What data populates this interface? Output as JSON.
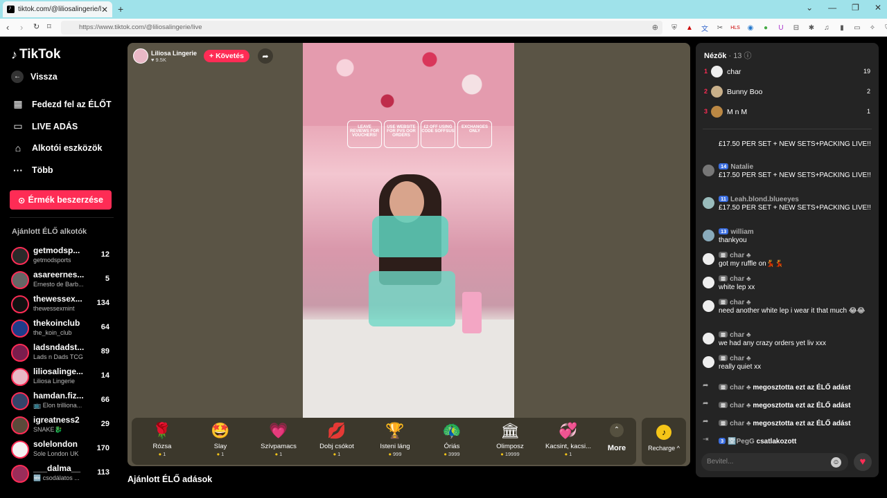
{
  "browser": {
    "tab_title": "tiktok.com/@liliosalingerie/li",
    "url": "https://www.tiktok.com/@liliosalingerie/live"
  },
  "sidebar": {
    "logo": "TikTok",
    "back": "Vissza",
    "items": [
      {
        "label": "Fedezd fel az ÉLŐT",
        "icon": "calendar-icon"
      },
      {
        "label": "LIVE ADÁS",
        "icon": "video-camera-icon"
      },
      {
        "label": "Alkotói eszközök",
        "icon": "lightbulb-icon"
      },
      {
        "label": "Több",
        "icon": "more-dots-icon"
      }
    ],
    "coins_button": "Érmék beszerzése",
    "section_title": "Ajánlott ÉLŐ alkotók",
    "creators": [
      {
        "name": "getmodsp...",
        "sub": "getmodsports",
        "count": "12"
      },
      {
        "name": "asareernes...",
        "sub": "Ernesto de Barb...",
        "count": "5"
      },
      {
        "name": "thewessex...",
        "sub": "thewessexmint",
        "count": "134"
      },
      {
        "name": "thekoinclub",
        "sub": "the_koin_club",
        "count": "64"
      },
      {
        "name": "ladsndadst...",
        "sub": "Lads n Dads TCG",
        "count": "89"
      },
      {
        "name": "liliosalinge...",
        "sub": "Liliosa Lingerie",
        "count": "14"
      },
      {
        "name": "hamdan.fiz...",
        "sub": "📺 Elon trilliona...",
        "count": "66"
      },
      {
        "name": "igreatness2",
        "sub": "SNAKE🐉",
        "count": "29"
      },
      {
        "name": "solelondon",
        "sub": "Sole London UK",
        "count": "170"
      },
      {
        "name": "___dalma__",
        "sub": "🆕 csodálatos ...",
        "count": "113"
      }
    ]
  },
  "stream": {
    "host_name": "Liliosa Lingerie",
    "host_likes": "♥ 9.5K",
    "follow": "+ Követés",
    "signs": [
      "LEAVE REVIEWS FOR VOUCHERS!",
      "USE WEBSITE FOR PVS OOR ORDERS",
      "£2 OFF USING CODE SOFFSUS",
      "EXCHANGES ONLY"
    ],
    "gifts": [
      {
        "name": "Rózsa",
        "price": "1",
        "icon": "🌹"
      },
      {
        "name": "Slay",
        "price": "1",
        "icon": "🤩"
      },
      {
        "name": "Szívpamacs",
        "price": "1",
        "icon": "💗"
      },
      {
        "name": "Dobj csókot",
        "price": "1",
        "icon": "💋"
      },
      {
        "name": "Isteni láng",
        "price": "999",
        "icon": "🏆"
      },
      {
        "name": "Óriás",
        "price": "3999",
        "icon": "🦚"
      },
      {
        "name": "Olimposz",
        "price": "19999",
        "icon": "🏛"
      },
      {
        "name": "Kacsint, kacsi...",
        "price": "1",
        "icon": "💞"
      }
    ],
    "more": "More",
    "recharge": "Recharge ^"
  },
  "recommended_title": "Ajánlott ÉLŐ adások",
  "chat": {
    "viewers_label": "Nézők",
    "viewers_count": "· 13",
    "viewers": [
      {
        "rank": "1",
        "name": "char",
        "score": "19"
      },
      {
        "rank": "2",
        "name": "Bunny Boo",
        "score": "2"
      },
      {
        "rank": "3",
        "name": "M n M",
        "score": "1"
      }
    ],
    "messages": [
      {
        "user": "",
        "level": "",
        "text": "£17.50 PER SET + NEW SETS+PACKING LIVE!!"
      },
      {
        "user": "Natalie",
        "level": "14",
        "text": "£17.50 PER SET + NEW SETS+PACKING LIVE!!"
      },
      {
        "user": "Leah.blond.blueeyes",
        "level": "11",
        "text": "£17.50 PER SET + NEW SETS+PACKING LIVE!!"
      },
      {
        "user": "william",
        "level": "13",
        "text": "thankyou"
      },
      {
        "user": "char",
        "level": "",
        "text": "got my ruffle on💃💃"
      },
      {
        "user": "char",
        "level": "",
        "text": "white lep xx"
      },
      {
        "user": "char",
        "level": "",
        "text": "need another white lep i wear it that much 😂😂"
      },
      {
        "user": "char",
        "level": "",
        "text": "we had any crazy orders yet liv xxx"
      },
      {
        "user": "char",
        "level": "",
        "text": "really quiet xx"
      }
    ],
    "events": [
      {
        "user": "char",
        "text": "megosztotta ezt az ÉLŐ adást"
      },
      {
        "user": "char",
        "text": "megosztotta ezt az ÉLŐ adást"
      },
      {
        "user": "char",
        "text": "megosztotta ezt az ÉLŐ adást"
      },
      {
        "user": "🈳PegG",
        "level": "3",
        "text": "csatlakozott"
      }
    ],
    "input_placeholder": "Bevitel..."
  }
}
